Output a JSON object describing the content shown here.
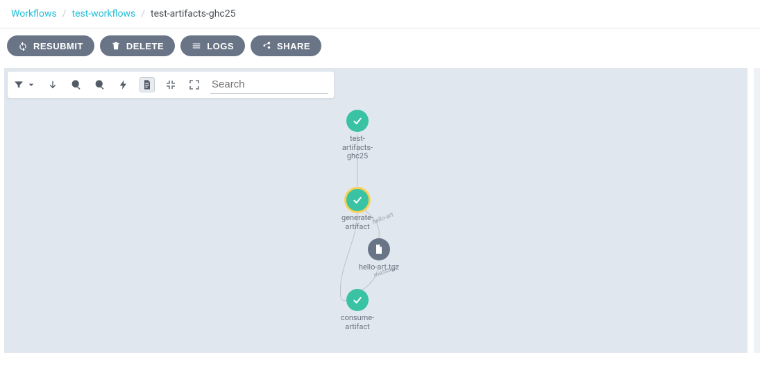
{
  "breadcrumb": {
    "root": "Workflows",
    "namespace": "test-workflows",
    "current": "test-artifacts-ghc25"
  },
  "actions": {
    "resubmit": "RESUBMIT",
    "delete": "DELETE",
    "logs": "LOGS",
    "share": "SHARE"
  },
  "toolbar": {
    "search_placeholder": "Search"
  },
  "nodes": {
    "root": {
      "label_l1": "test-artifacts-",
      "label_l2": "ghc25"
    },
    "generate": {
      "label_l1": "generate-",
      "label_l2": "artifact"
    },
    "artifact": {
      "label_l1": "hello-art.tgz"
    },
    "consume": {
      "label_l1": "consume-",
      "label_l2": "artifact"
    }
  },
  "edges": {
    "hello_art": "hello-art",
    "message": "message"
  }
}
